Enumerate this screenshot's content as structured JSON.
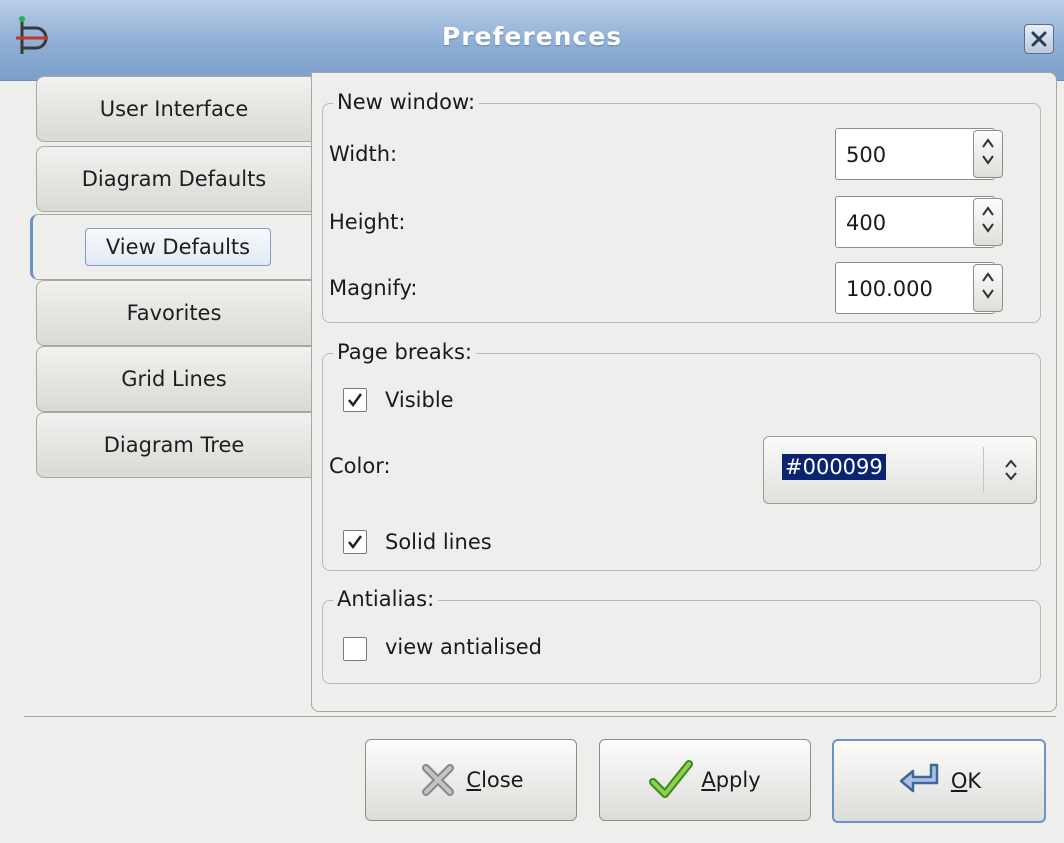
{
  "window": {
    "title": "Preferences"
  },
  "tabs": [
    {
      "label": "User Interface"
    },
    {
      "label": "Diagram Defaults"
    },
    {
      "label": "View Defaults"
    },
    {
      "label": "Favorites"
    },
    {
      "label": "Grid Lines"
    },
    {
      "label": "Diagram Tree"
    }
  ],
  "new_window": {
    "legend": "New window:",
    "width_label": "Width:",
    "width_value": "500",
    "height_label": "Height:",
    "height_value": "400",
    "magnify_label": "Magnify:",
    "magnify_value": "100.000"
  },
  "page_breaks": {
    "legend": "Page breaks:",
    "visible_label": "Visible",
    "visible_checked": true,
    "color_label": "Color:",
    "color_value": "#000099",
    "solid_label": "Solid lines",
    "solid_checked": true
  },
  "antialias": {
    "legend": "Antialias:",
    "view_label": "view antialised",
    "view_checked": false
  },
  "buttons": {
    "close_mnemonic": "C",
    "close_rest": "lose",
    "apply_mnemonic": "A",
    "apply_rest": "pply",
    "ok_mnemonic": "O",
    "ok_rest": "K"
  }
}
